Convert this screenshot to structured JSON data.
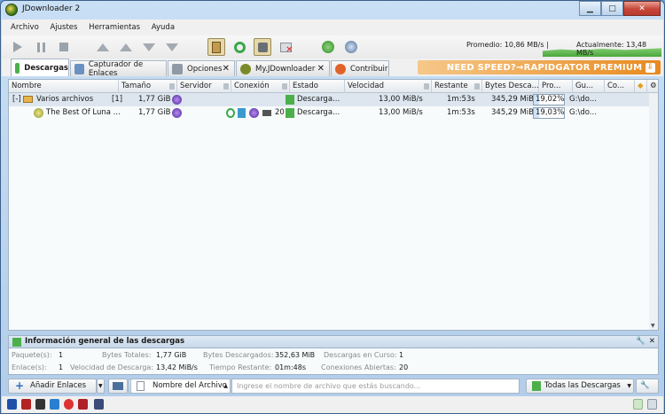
{
  "window": {
    "title": "JDownloader 2"
  },
  "menu": [
    "Archivo",
    "Ajustes",
    "Herramientas",
    "Ayuda"
  ],
  "speed": {
    "average": "Promedio: 10,86 MB/s |",
    "current": "Actualmente: 13,48 MB/s"
  },
  "tabs": [
    {
      "label": "Descargas",
      "closable": false
    },
    {
      "label": "Capturador de Enlaces",
      "closable": false
    },
    {
      "label": "Opciones",
      "closable": true
    },
    {
      "label": "My.JDownloader",
      "closable": true
    },
    {
      "label": "Contribuir",
      "closable": false
    }
  ],
  "banner": "NEED SPEED?→RAPIDGATOR PREMIUM",
  "columns": [
    "Nombre",
    "Tamaño",
    "Servidor",
    "Conexión",
    "Estado",
    "Velocidad",
    "Restante",
    "Bytes Desca...",
    "Pro...",
    "Gu...",
    "Co..."
  ],
  "package": {
    "expander": "[-]",
    "name": "Varios archivos",
    "count": "[1]",
    "size": "1,77 GiB",
    "status": "Descarga...",
    "speed": "13,00 MiB/s",
    "remaining": "1m:53s",
    "bytes": "345,29 MiB",
    "progress_label": "19,02%",
    "progress": 0.1902,
    "folder": "G:\\do..."
  },
  "file": {
    "name": "The Best Of Luna ...",
    "size": "1,77 GiB",
    "connections": "20",
    "status": "Descarga...",
    "speed": "13,00 MiB/s",
    "remaining": "1m:53s",
    "bytes": "345,29 MiB",
    "progress_label": "19,03%",
    "progress": 0.1903,
    "folder": "G:\\do..."
  },
  "info": {
    "title": "Información general de las descargas",
    "packages_label": "Paquete(s):",
    "packages": "1",
    "links_label": "Enlace(s):",
    "links": "1",
    "total_label": "Bytes Totales:",
    "total": "1,77 GiB",
    "speed_label": "Velocidad de Descarga:",
    "speed": "13,42 MiB/s",
    "downloaded_label": "Bytes Descargados:",
    "downloaded": "352,63 MiB",
    "remaining_label": "Tiempo Restante:",
    "remaining": "01m:48s",
    "running_label": "Descargas en Curso:",
    "running": "1",
    "open_label": "Conexiones Abiertas:",
    "open": "20"
  },
  "bottom": {
    "add_links": "Añadir Enlaces",
    "search_field": "Nombre del Archivo",
    "search_placeholder": "Ingrese el nombre de archivo que estás buscando...",
    "filter": "Todas las Descargas"
  }
}
